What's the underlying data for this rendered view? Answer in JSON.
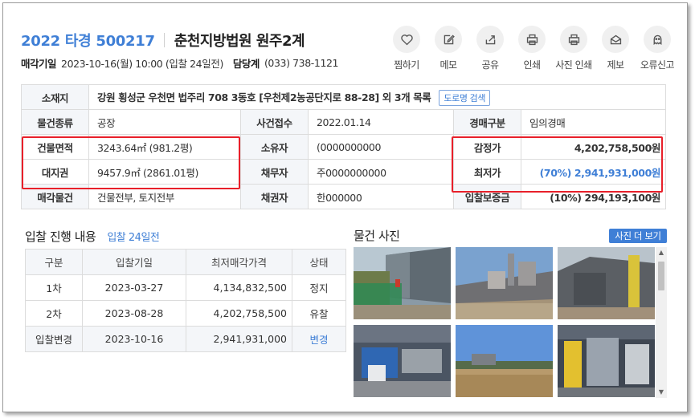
{
  "header": {
    "case_no": "2022 타경 500217",
    "court": "춘천지방법원 원주2계",
    "sale_date_label": "매각기일",
    "sale_date_value": "2023-10-16(월) 10:00 (입찰 24일전)",
    "dept_label": "담당계",
    "dept_value": "(033) 738-1121"
  },
  "actions": [
    {
      "label": "찜하기",
      "icon": "heart-icon"
    },
    {
      "label": "메모",
      "icon": "memo-icon"
    },
    {
      "label": "공유",
      "icon": "share-icon"
    },
    {
      "label": "인쇄",
      "icon": "print-icon"
    },
    {
      "label": "사진 인쇄",
      "icon": "photo-print-icon"
    },
    {
      "label": "제보",
      "icon": "report-icon"
    },
    {
      "label": "오류신고",
      "icon": "error-report-icon"
    }
  ],
  "info": {
    "location_label": "소재지",
    "location_value": "강원 횡성군 우천면 법주리 708 3동호 [우천제2농공단지로 88-28] 외 3개 목록",
    "road_btn": "도로명 검색",
    "type_label": "물건종류",
    "type_value": "공장",
    "received_label": "사건접수",
    "received_value": "2022.01.14",
    "auction_type_label": "경매구분",
    "auction_type_value": "임의경매",
    "building_area_label": "건물면적",
    "building_area_value": "3243.64㎡ (981.2평)",
    "owner_label": "소유자",
    "owner_value": "(0000000000",
    "appraisal_label": "감정가",
    "appraisal_value": "4,202,758,500원",
    "land_label": "대지권",
    "land_value": "9457.9㎡ (2861.01평)",
    "debtor_label": "채무자",
    "debtor_value": "주0000000000",
    "min_price_label": "최저가",
    "min_price_value": "(70%) 2,941,931,000원",
    "sale_items_label": "매각물건",
    "sale_items_value": "건물전부, 토지전부",
    "creditor_label": "채권자",
    "creditor_value": "한000000",
    "deposit_label": "입찰보증금",
    "deposit_value": "(10%) 294,193,100원"
  },
  "bidding": {
    "title": "입찰 진행 내용",
    "subtitle": "입찰 24일전",
    "columns": [
      "구분",
      "입찰기일",
      "최저매각가격",
      "상태"
    ],
    "rows": [
      {
        "round": "1차",
        "date": "2023-03-27",
        "price": "4,134,832,500",
        "status": "정지"
      },
      {
        "round": "2차",
        "date": "2023-08-28",
        "price": "4,202,758,500",
        "status": "유찰"
      },
      {
        "round": "입찰변경",
        "date": "2023-10-16",
        "price": "2,941,931,000",
        "status": "변경"
      }
    ]
  },
  "photos": {
    "title": "물건 사진",
    "more_btn": "사진 더 보기"
  },
  "colors": {
    "accent": "#3f7fd6",
    "highlight": "#e8202a"
  }
}
